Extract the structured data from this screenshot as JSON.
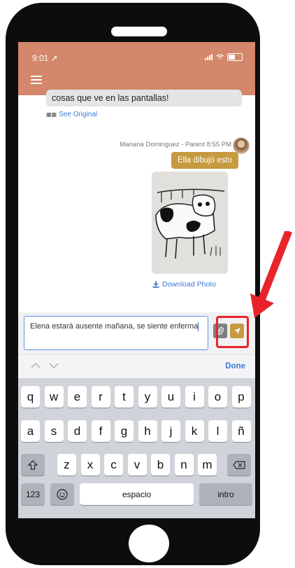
{
  "status_bar": {
    "time": "9:01",
    "location_icon": "location-arrow-icon",
    "signal_icon": "cellular-signal-icon",
    "wifi_icon": "wifi-icon",
    "battery_icon": "battery-icon"
  },
  "header": {
    "menu_icon": "hamburger-menu-icon"
  },
  "chat": {
    "incoming_text": "cosas que ve en las pantallas!",
    "see_original_label": "See Original",
    "sender_name": "Mariana Dominguez - Parent",
    "sent_time": "8:55 PM",
    "outgoing_text": "Ella dibujó esto",
    "download_label": "Download Photo"
  },
  "composer": {
    "message_value": "Elena estará ausente mañana, se siente enferma",
    "attach_icon": "paperclip-icon",
    "send_icon": "send-icon"
  },
  "keyboard": {
    "done_label": "Done",
    "row1": [
      "q",
      "w",
      "e",
      "r",
      "t",
      "y",
      "u",
      "i",
      "o",
      "p"
    ],
    "row2": [
      "a",
      "s",
      "d",
      "f",
      "g",
      "h",
      "j",
      "k",
      "l",
      "ñ"
    ],
    "row3": [
      "z",
      "x",
      "c",
      "v",
      "b",
      "n",
      "m"
    ],
    "numbers_label": "123",
    "space_label": "espacio",
    "return_label": "intro"
  },
  "colors": {
    "header": "#d4876a",
    "accent": "#c69a3e",
    "link": "#3a7bd5",
    "callout": "#e8232b"
  }
}
